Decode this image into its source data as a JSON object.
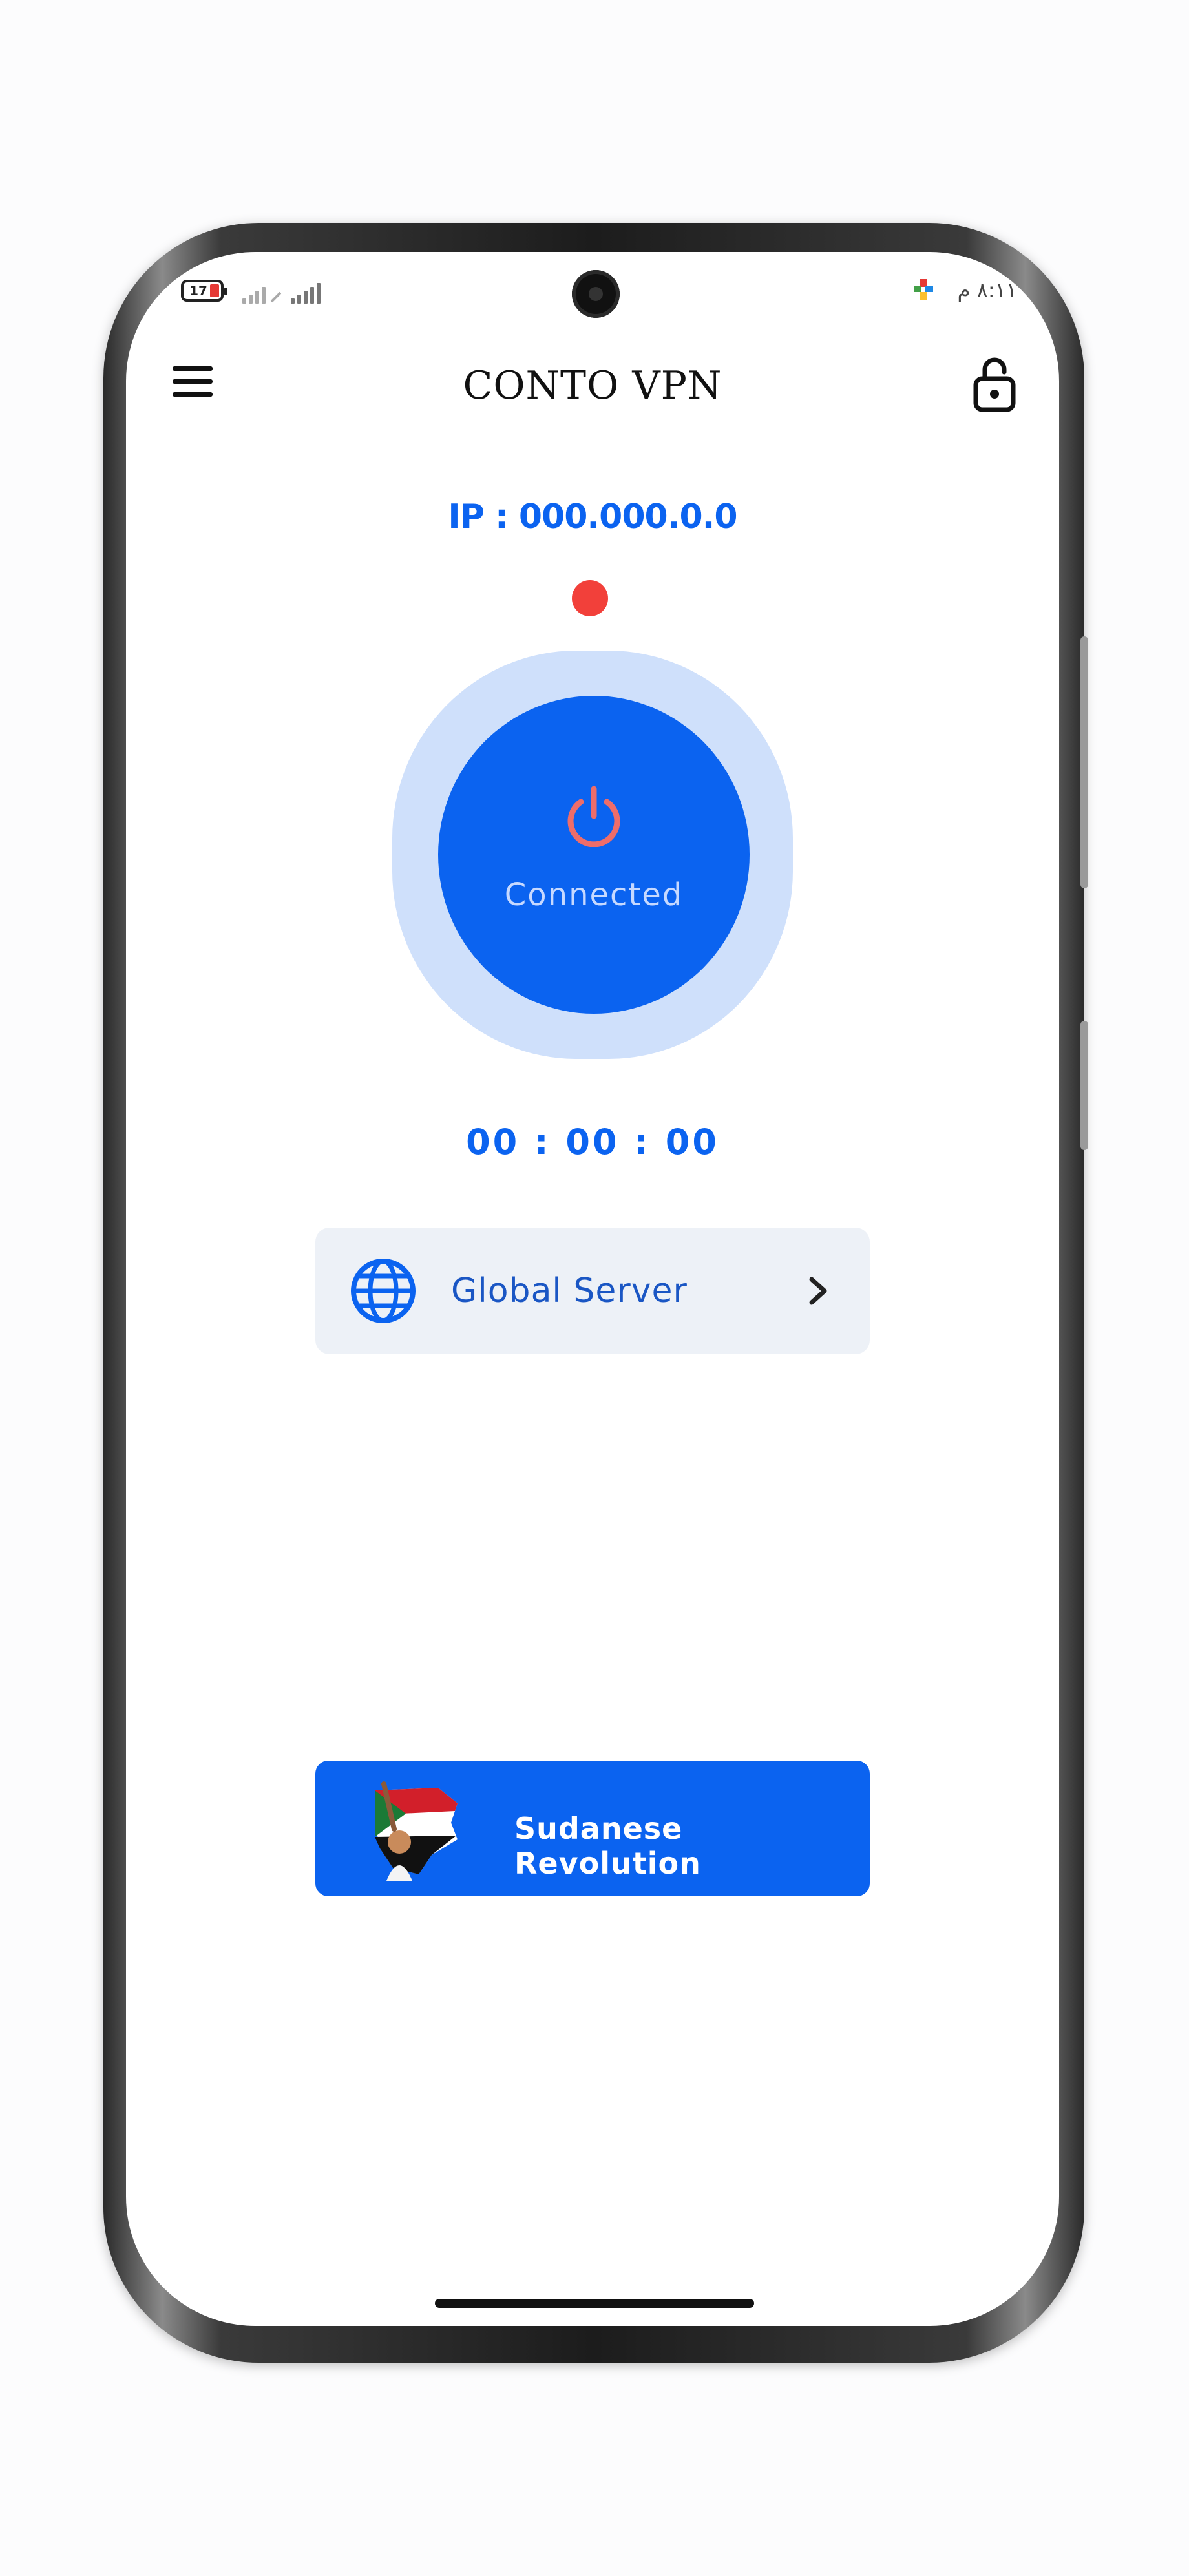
{
  "status_bar": {
    "battery": "17",
    "time": "٨:١١ م"
  },
  "app_bar": {
    "title": "CONTO VPN"
  },
  "connection": {
    "ip": "IP : 000.000.0.0",
    "power_label": "Connected",
    "timer": "00 : 00 : 00"
  },
  "server": {
    "label": "Global Server"
  },
  "banner": {
    "label": "Sudanese Revolution"
  },
  "colors": {
    "accent": "#0b63f0",
    "accent_light": "#cfe0fb",
    "status_dot": "#f2403a",
    "card_bg": "#edf1f7"
  },
  "icons": [
    "menu-icon",
    "lock-icon",
    "power-icon",
    "globe-icon",
    "chevron-right-icon"
  ]
}
